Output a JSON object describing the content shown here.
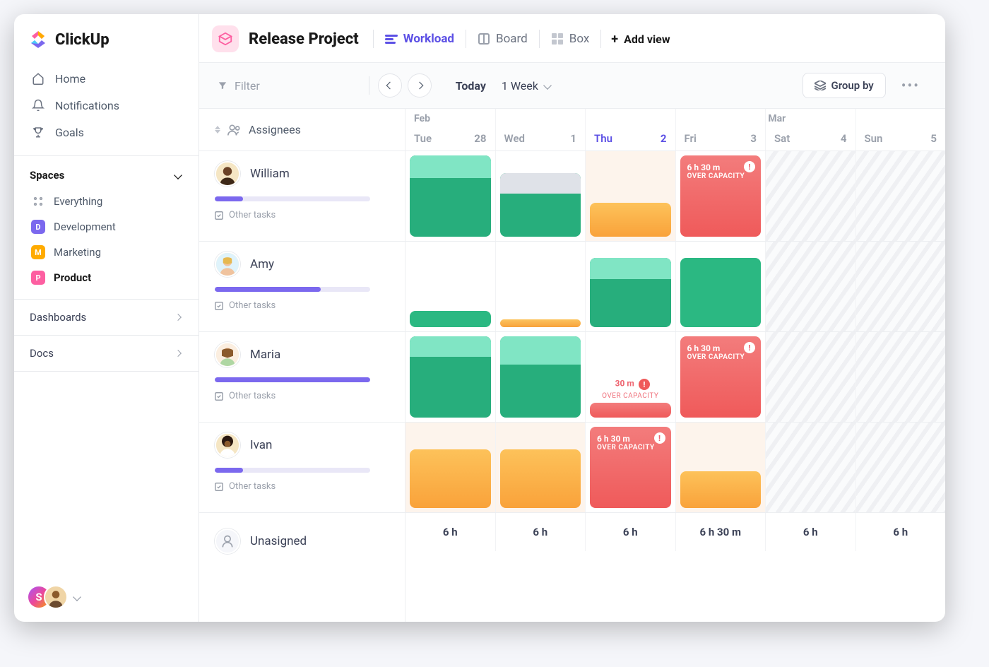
{
  "logo": {
    "text": "ClickUp"
  },
  "nav": {
    "home": "Home",
    "notifications": "Notifications",
    "goals": "Goals"
  },
  "spaces": {
    "header": "Spaces",
    "everything": "Everything",
    "items": [
      {
        "letter": "D",
        "label": "Development",
        "color": "#7b68ee"
      },
      {
        "letter": "M",
        "label": "Marketing",
        "color": "#ffab00"
      },
      {
        "letter": "P",
        "label": "Product",
        "color": "#fd5fa1",
        "active": true
      }
    ]
  },
  "sections": {
    "dashboards": "Dashboards",
    "docs": "Docs"
  },
  "profile": {
    "initial": "S"
  },
  "header": {
    "projectTitle": "Release Project",
    "views": {
      "workload": "Workload",
      "board": "Board",
      "box": "Box",
      "add": "Add view"
    }
  },
  "toolbar": {
    "filter": "Filter",
    "today": "Today",
    "range": "1 Week",
    "groupBy": "Group by"
  },
  "calendar": {
    "leftHeader": "Assignees",
    "monthLeft": "Feb",
    "monthRight": "Mar",
    "days": [
      {
        "dow": "Tue",
        "num": "28"
      },
      {
        "dow": "Wed",
        "num": "1"
      },
      {
        "dow": "Thu",
        "num": "2",
        "current": true
      },
      {
        "dow": "Fri",
        "num": "3"
      },
      {
        "dow": "Sat",
        "num": "4",
        "weekend": true
      },
      {
        "dow": "Sun",
        "num": "5",
        "weekend": true
      }
    ],
    "footer": [
      "6 h",
      "6 h",
      "6 h",
      "6 h 30 m",
      "6 h",
      "6 h"
    ]
  },
  "assignees": [
    {
      "name": "William",
      "progress": 18,
      "otherTasks": "Other tasks"
    },
    {
      "name": "Amy",
      "progress": 68,
      "otherTasks": "Other tasks"
    },
    {
      "name": "Maria",
      "progress": 100,
      "otherTasks": "Other tasks"
    },
    {
      "name": "Ivan",
      "progress": 18,
      "otherTasks": "Other tasks"
    },
    {
      "name": "Unasigned"
    }
  ],
  "overCapacity": {
    "time": "6 h 30 m",
    "label": "OVER CAPACITY",
    "shortTime": "30 m"
  },
  "unassignedIcon": "person"
}
